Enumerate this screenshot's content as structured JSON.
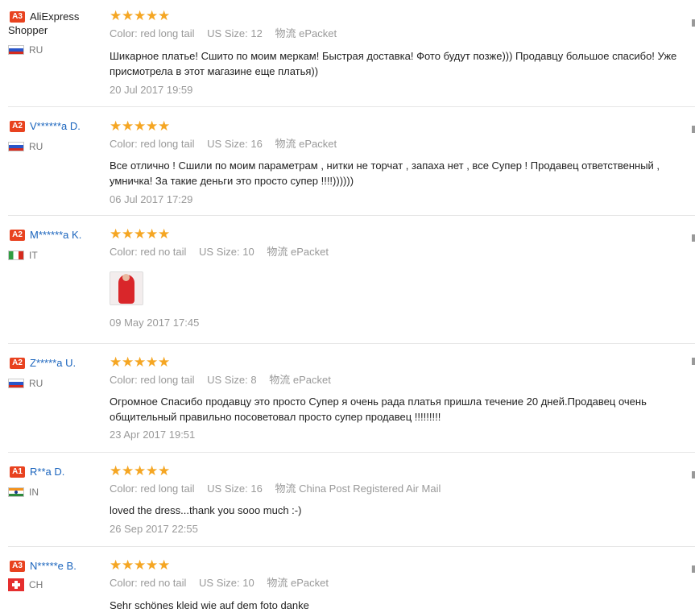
{
  "labels": {
    "color": "Color:",
    "size": "US Size:",
    "shipping": "物流"
  },
  "reviews": [
    {
      "level": "A3",
      "name": "AliExpress Shopper",
      "name_line1": "AliExpress",
      "name_line2": "Shopper",
      "country": "RU",
      "rating": 5,
      "color": "red long tail",
      "size": "12",
      "shipping": "ePacket",
      "text_line1": "Шикарное платье! Сшито по моим меркам! Быстрая доставка! Фото будут позже))) Продавцу большое спасибо! Уже",
      "text_line2": "присмотрела в этот магазине еще платья))",
      "date": "20 Jul 2017 19:59"
    },
    {
      "level": "A2",
      "name": "V******a D.",
      "country": "RU",
      "rating": 5,
      "color": "red long tail",
      "size": "16",
      "shipping": "ePacket",
      "text_line1": "Все отлично ! Сшили по моим параметрам , нитки не торчат , запаха нет , все Супер ! Продавец ответственный ,",
      "text_line2": "умничка! За такие деньги это просто супер !!!!))))))",
      "date": "06 Jul 2017 17:29"
    },
    {
      "level": "A2",
      "name": "M******a K.",
      "country": "IT",
      "rating": 5,
      "color": "red no tail",
      "size": "10",
      "shipping": "ePacket",
      "date": "09 May 2017 17:45"
    },
    {
      "level": "A2",
      "name": "Z*****a U.",
      "country": "RU",
      "rating": 5,
      "color": "red long tail",
      "size": "8",
      "shipping": "ePacket",
      "text_line1": "Огромное Спасибо продавцу это просто Супер я очень рада платья пришла течение 20 дней.Продавец очень",
      "text_line2": "общительный правильно посоветовал просто супер продавец !!!!!!!!!",
      "date": "23 Apr 2017 19:51"
    },
    {
      "level": "A1",
      "name": "R**a D.",
      "country": "IN",
      "rating": 5,
      "color": "red long tail",
      "size": "16",
      "shipping": "China Post Registered Air Mail",
      "text_line1": "loved the dress...thank you sooo much :-)",
      "date": "26 Sep 2017 22:55"
    },
    {
      "level": "A3",
      "name": "N*****e B.",
      "country": "CH",
      "rating": 5,
      "color": "red no tail",
      "size": "10",
      "shipping": "ePacket",
      "text_line1": "Sehr schönes kleid wie auf dem foto danke"
    }
  ],
  "colors": {
    "badge": "#e8421f",
    "link": "#1a64bd",
    "star": "#f5a623",
    "muted": "#999999"
  },
  "icons": [
    "star-icon",
    "flag-icon",
    "photo-thumbnail"
  ]
}
